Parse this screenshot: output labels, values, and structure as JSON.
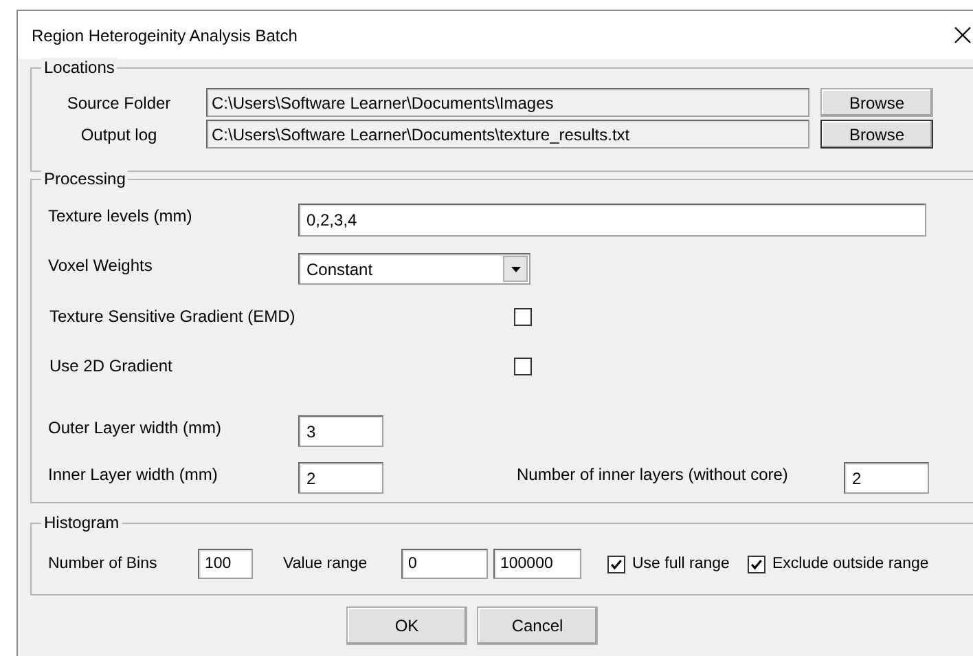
{
  "window": {
    "title": "Region Heterogeinity Analysis Batch"
  },
  "locations": {
    "title": "Locations",
    "rows": [
      {
        "label": "Source Folder",
        "value": "C:\\Users\\Software Learner\\Documents\\Images",
        "button": "Browse"
      },
      {
        "label": "Output log",
        "value": "C:\\Users\\Software Learner\\Documents\\texture_results.txt",
        "button": "Browse"
      }
    ]
  },
  "processing": {
    "title": "Processing",
    "texture_levels": {
      "label": "Texture levels (mm)",
      "value": "0,2,3,4"
    },
    "voxel_weights": {
      "label": "Voxel Weights",
      "value": "Constant"
    },
    "checkboxes": [
      {
        "label": "Texture Sensitive Gradient (EMD)",
        "checked": false
      },
      {
        "label": "Use 2D Gradient",
        "checked": false
      }
    ],
    "outer_layer_width": {
      "label": "Outer Layer width (mm)",
      "value": "3"
    },
    "inner_layer_width": {
      "label": "Inner Layer width (mm)",
      "value": "2"
    },
    "inner_layer_count": {
      "label": "Number of inner layers (without core)",
      "value": "2"
    }
  },
  "histogram": {
    "title": "Histogram",
    "bins": {
      "label": "Number of Bins",
      "value": "100"
    },
    "value_range": {
      "label": "Value range",
      "min": "0",
      "max": "100000"
    },
    "options": [
      {
        "label": "Use full range",
        "checked": true
      },
      {
        "label": "Exclude outside range",
        "checked": true
      }
    ]
  },
  "buttons": [
    {
      "label": "OK"
    },
    {
      "label": "Cancel"
    }
  ]
}
